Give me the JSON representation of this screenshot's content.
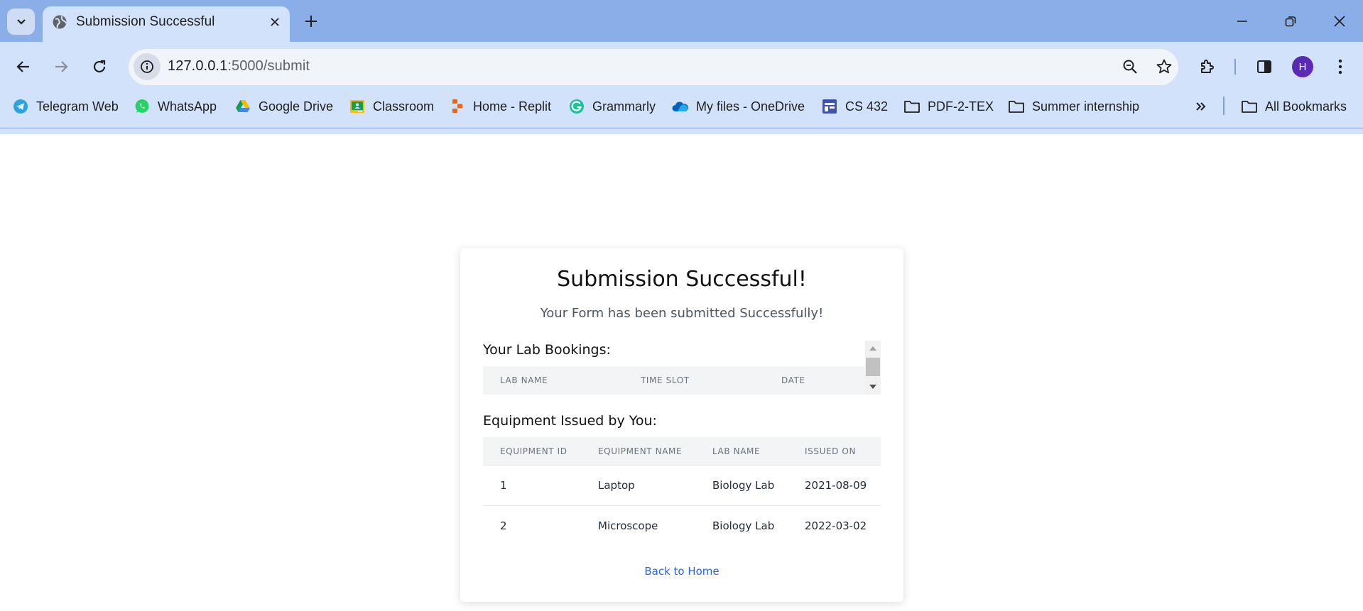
{
  "browser": {
    "tab": {
      "title": "Submission Successful",
      "favicon": "globe-icon"
    },
    "address": {
      "host": "127.0.0.1",
      "path": ":5000/submit"
    },
    "profile_initial": "H",
    "colors": {
      "tabstrip": "#8aaee8",
      "toolbar": "#d3e2fb",
      "avatar": "#5b2ab4"
    },
    "bookmarks": [
      {
        "label": "Telegram Web",
        "icon": "telegram-icon"
      },
      {
        "label": "WhatsApp",
        "icon": "whatsapp-icon"
      },
      {
        "label": "Google Drive",
        "icon": "google-drive-icon"
      },
      {
        "label": "Classroom",
        "icon": "classroom-icon"
      },
      {
        "label": "Home - Replit",
        "icon": "replit-icon"
      },
      {
        "label": "Grammarly",
        "icon": "grammarly-icon"
      },
      {
        "label": "My files - OneDrive",
        "icon": "onedrive-icon"
      },
      {
        "label": "CS 432",
        "icon": "calendar-icon"
      },
      {
        "label": "PDF-2-TEX",
        "icon": "folder-icon"
      },
      {
        "label": "Summer internship",
        "icon": "folder-icon"
      }
    ],
    "all_bookmarks_label": "All Bookmarks"
  },
  "page": {
    "title": "Submission Successful!",
    "subtitle": "Your Form has been submitted Successfully!",
    "bookings": {
      "heading": "Your Lab Bookings:",
      "columns": [
        "LAB NAME",
        "TIME SLOT",
        "DATE"
      ],
      "rows": []
    },
    "equipment": {
      "heading": "Equipment Issued by You:",
      "columns": [
        "EQUIPMENT ID",
        "EQUIPMENT NAME",
        "LAB NAME",
        "ISSUED ON"
      ],
      "rows": [
        [
          "1",
          "Laptop",
          "Biology Lab",
          "2021-08-09"
        ],
        [
          "2",
          "Microscope",
          "Biology Lab",
          "2022-03-02"
        ]
      ]
    },
    "back_link": "Back to Home",
    "colors": {
      "link": "#2563eb",
      "table_header_bg": "#f3f4f6"
    }
  }
}
